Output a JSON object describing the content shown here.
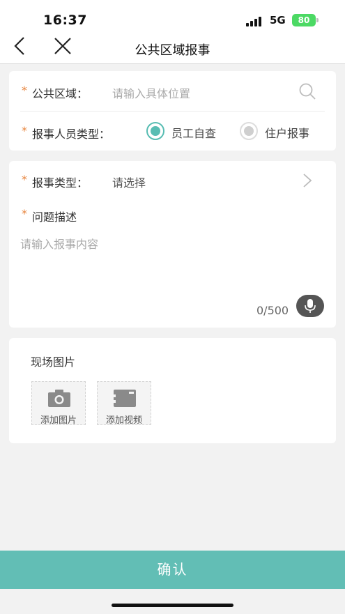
{
  "status": {
    "time": "16:37",
    "network": "5G",
    "battery": "80"
  },
  "nav": {
    "title": "公共区域报事"
  },
  "location": {
    "required_mark": "*",
    "label": "公共区域：",
    "placeholder": "请输入具体位置"
  },
  "reporter_type": {
    "required_mark": "*",
    "label": "报事人员类型：",
    "options": [
      {
        "label": "员工自查",
        "selected": true
      },
      {
        "label": "住户报事",
        "selected": false
      }
    ]
  },
  "report_type": {
    "required_mark": "*",
    "label": "报事类型：",
    "value": "请选择"
  },
  "description": {
    "required_mark": "*",
    "label": "问题描述",
    "placeholder": "请输入报事内容",
    "counter": "0/500"
  },
  "photos": {
    "title": "现场图片",
    "add_photo": "添加图片",
    "add_video": "添加视频"
  },
  "confirm_label": "确认",
  "colors": {
    "accent": "#62beb5",
    "required": "#e8843c"
  }
}
